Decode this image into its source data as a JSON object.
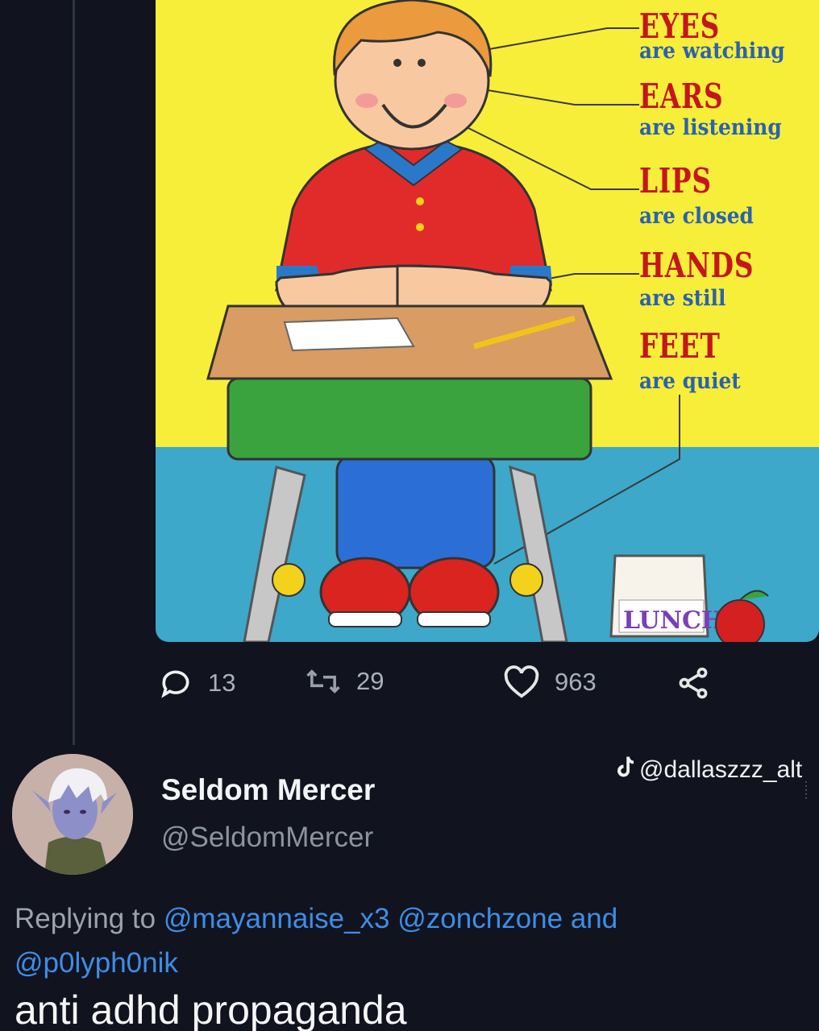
{
  "poster": {
    "lines": [
      {
        "head": "EYES",
        "sub": "are watching"
      },
      {
        "head": "EARS",
        "sub": "are listening"
      },
      {
        "head": "LIPS",
        "sub": "are closed"
      },
      {
        "head": "HANDS",
        "sub": "are still"
      },
      {
        "head": "FEET",
        "sub": "are quiet"
      }
    ],
    "lunch_label": "LUNCH"
  },
  "actions": {
    "reply_icon": "speech-bubble-icon",
    "reply_count": "13",
    "retweet_icon": "retweet-icon",
    "retweet_count": "29",
    "like_icon": "heart-icon",
    "like_count": "963",
    "share_icon": "share-icon"
  },
  "watermark": {
    "icon": "tiktok-icon",
    "text": "@dallaszzz_alt"
  },
  "reply_tweet": {
    "display_name": "Seldom Mercer",
    "handle": "@SeldomMercer",
    "replying_prefix": "Replying to",
    "mentions": [
      "@mayannaise_x3",
      "@zonchzone",
      "@p0lyph0nik"
    ],
    "conjunction": "and",
    "text": "anti adhd propaganda"
  },
  "colors": {
    "background": "#11131f",
    "poster_yellow": "#f7ee3a",
    "poster_floor": "#3da8c9",
    "mention_blue": "#3d8ee6"
  }
}
